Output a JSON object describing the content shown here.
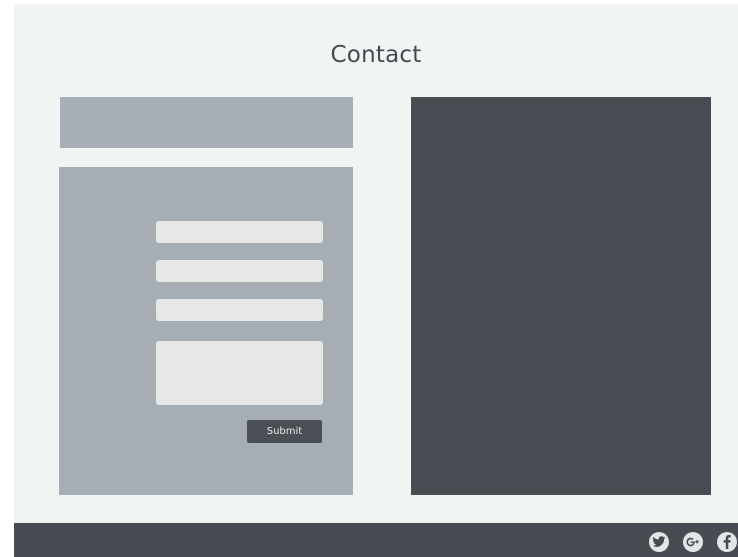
{
  "page": {
    "title": "Contact"
  },
  "form": {
    "fields": [
      {
        "name": "name",
        "value": "",
        "placeholder": ""
      },
      {
        "name": "email",
        "value": "",
        "placeholder": ""
      },
      {
        "name": "subject",
        "value": "",
        "placeholder": ""
      },
      {
        "name": "message",
        "value": "",
        "placeholder": ""
      }
    ],
    "submit_label": "Submit"
  },
  "footer": {
    "social_icons": [
      "twitter-icon",
      "google-plus-icon",
      "facebook-icon"
    ]
  },
  "colors": {
    "background": "#f0f4f3",
    "panel_light": "#a6adb4",
    "panel_dark": "#474d53",
    "field": "#e6e8e5",
    "title_text": "#444a50"
  }
}
